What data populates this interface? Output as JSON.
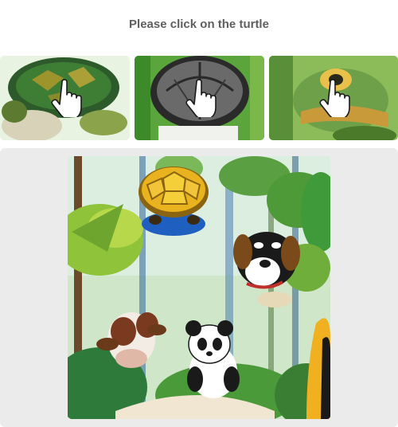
{
  "captcha": {
    "prompt": "Please click on the turtle",
    "thumbnails": [
      {
        "subject": "turtle",
        "icon": "pointer-hand-icon"
      },
      {
        "subject": "turtle-shell",
        "icon": "pointer-hand-icon"
      },
      {
        "subject": "turtle-head",
        "icon": "pointer-hand-icon"
      }
    ],
    "scene_animals": [
      "turtle",
      "dog",
      "cow",
      "panda",
      "toucan"
    ]
  },
  "colors": {
    "prompt_text": "#5f5f5f",
    "panel_bg": "#ebebeb",
    "jungle_green": "#3f9a3a",
    "shell_yellow": "#e8b31e"
  }
}
